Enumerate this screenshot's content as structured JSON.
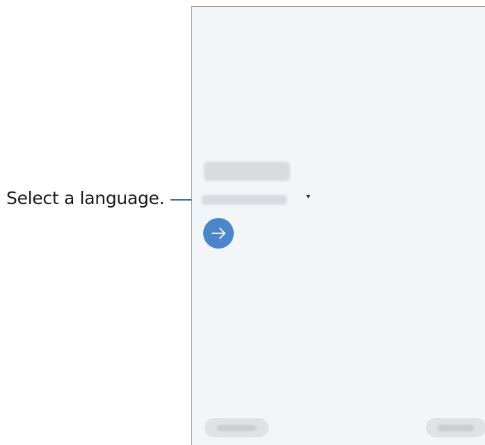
{
  "callout": {
    "text": "Select a language."
  },
  "colors": {
    "accent": "#4a86c9",
    "callout_line": "#2f6ea8",
    "screen_background": "#f3f6f8"
  },
  "icons": {
    "next": "arrow-right-icon",
    "dropdown": "caret-down-icon"
  }
}
